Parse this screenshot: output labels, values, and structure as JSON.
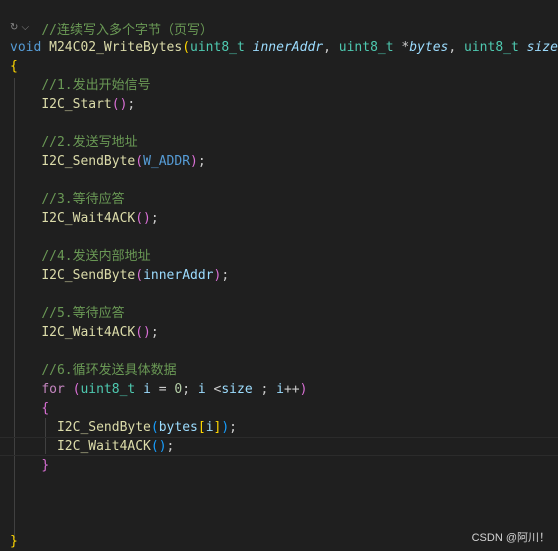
{
  "code": {
    "header_comment": "//连续写入多个字节（页写）",
    "codelens": "↻ ⌵",
    "sig": {
      "kw_void": "void",
      "func_name": "M24C02_WriteBytes",
      "open_paren": "(",
      "t1": "uint8_t",
      "p1": "innerAddr",
      "comma1": ", ",
      "t2": "uint8_t",
      "star": " *",
      "p2": "bytes",
      "comma2": ", ",
      "t3": "uint8_t",
      "p3": "size",
      "close_paren": ")"
    },
    "brace_open": "{",
    "brace_close": "}",
    "c1": "//1.发出开始信号",
    "l1_fn": "I2C_Start",
    "l1_args": "()",
    "semi": ";",
    "c2": "//2.发送写地址",
    "l2_fn": "I2C_SendByte",
    "l2_open": "(",
    "l2_arg": "W_ADDR",
    "l2_close": ")",
    "c3": "//3.等待应答",
    "l3_fn": "I2C_Wait4ACK",
    "l3_args": "()",
    "c4": "//4.发送内部地址",
    "l4_fn": "I2C_SendByte",
    "l4_open": "(",
    "l4_arg": "innerAddr",
    "l4_close": ")",
    "c5": "//5.等待应答",
    "l5_fn": "I2C_Wait4ACK",
    "l5_args": "()",
    "c6": "//6.循环发送具体数据",
    "for_kw": "for",
    "for_open": " (",
    "for_type": "uint8_t",
    "for_i": " i",
    "for_eq": " = ",
    "for_zero": "0",
    "for_semi1": "; ",
    "for_i2": "i",
    "for_lt": " <",
    "for_size": "size",
    "for_semi2": " ; ",
    "for_i3": "i",
    "for_inc": "++",
    "for_close": ")",
    "inner_open": "{",
    "inner_close": "}",
    "l7_fn": "I2C_SendByte",
    "l7_open": "(",
    "l7_arg": "bytes",
    "l7_bo": "[",
    "l7_idx": "i",
    "l7_bc": "]",
    "l7_close": ")",
    "l8_fn": "I2C_Wait4ACK",
    "l8_args": "()"
  },
  "watermark": "CSDN @阿川！"
}
